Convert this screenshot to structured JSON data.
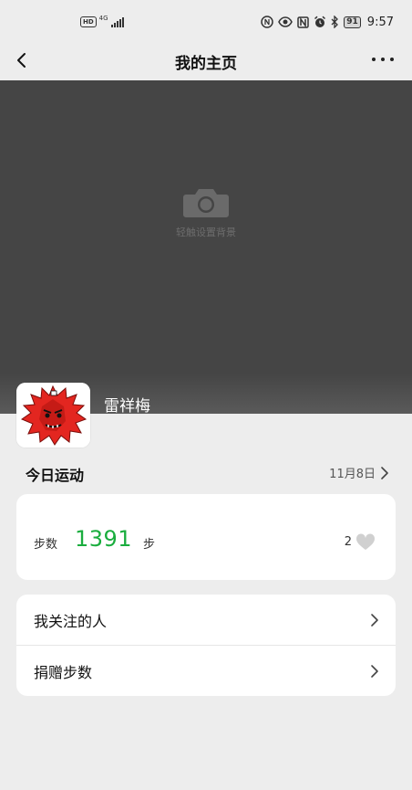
{
  "status_bar": {
    "hd": "HD",
    "network": "4G",
    "battery": "91",
    "time": "9:57",
    "icons": [
      "nfc-icon",
      "eye-icon",
      "n-icon",
      "alarm-icon",
      "bluetooth-icon"
    ]
  },
  "nav": {
    "title": "我的主页"
  },
  "cover": {
    "hint": "轻触设置背景"
  },
  "profile": {
    "name": "雷祥梅"
  },
  "today": {
    "title": "今日运动",
    "date": "11月8日"
  },
  "steps": {
    "label": "步数",
    "value": "1391",
    "unit": "步",
    "likes": "2"
  },
  "menu": {
    "items": [
      {
        "label": "我关注的人"
      },
      {
        "label": "捐赠步数"
      }
    ]
  },
  "colors": {
    "accent_green": "#1aad3e",
    "background": "#ededed",
    "cover": "#454545"
  }
}
